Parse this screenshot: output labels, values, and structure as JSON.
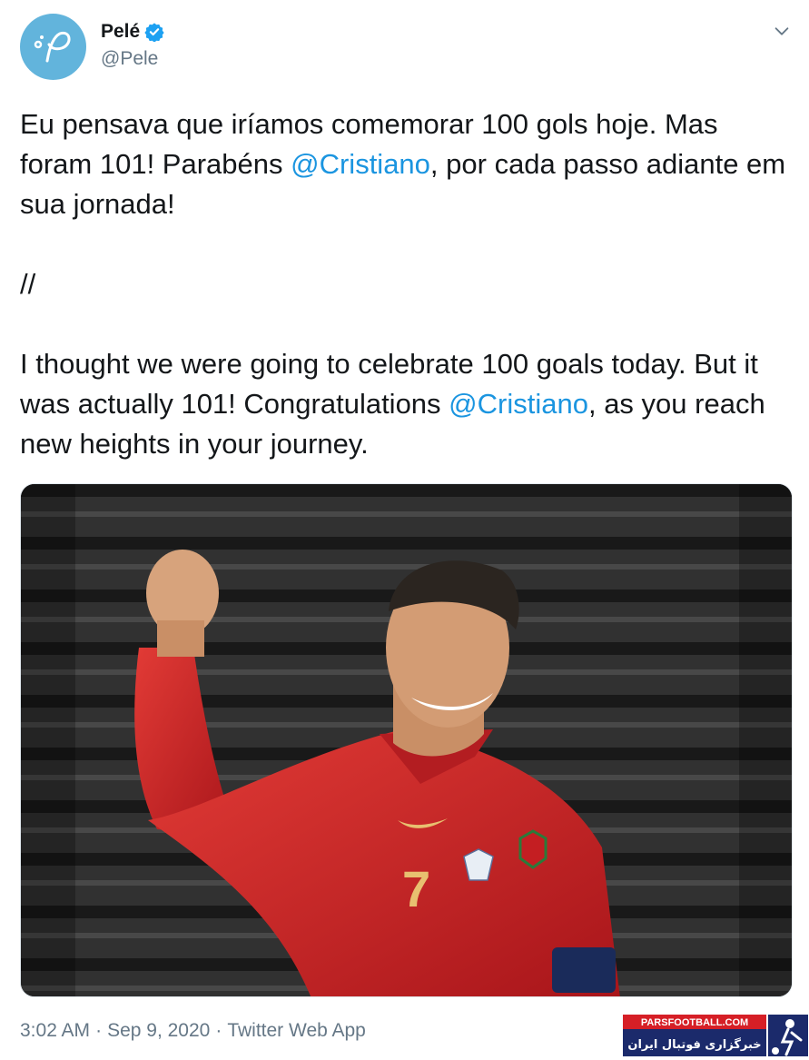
{
  "author": {
    "name": "Pelé",
    "handle": "@Pele",
    "verified": true,
    "avatar_icon": "pele-signature-logo",
    "avatar_color": "#62b4dc"
  },
  "tweet": {
    "pt_line1": "Eu pensava que iríamos comemorar 100 gols hoje. Mas foram 101! Parabéns ",
    "pt_mention": "@Cristiano",
    "pt_line2": ", por cada passo adiante em sua jornada!",
    "divider": "//",
    "en_line1": "I thought we were going to celebrate 100 goals today. But it was actually 101! Congratulations ",
    "en_mention": "@Cristiano",
    "en_line2": ", as you reach new heights in your journey.",
    "mention_color": "#1b95e0"
  },
  "media": {
    "jersey_number": "7"
  },
  "meta": {
    "time": "3:02 AM",
    "date": "Sep 9, 2020",
    "source": "Twitter Web App",
    "separator": "·"
  },
  "watermark": {
    "site": "PARSFOOTBALL.COM",
    "tagline": "خبرگزاری فوتبال ایران"
  }
}
